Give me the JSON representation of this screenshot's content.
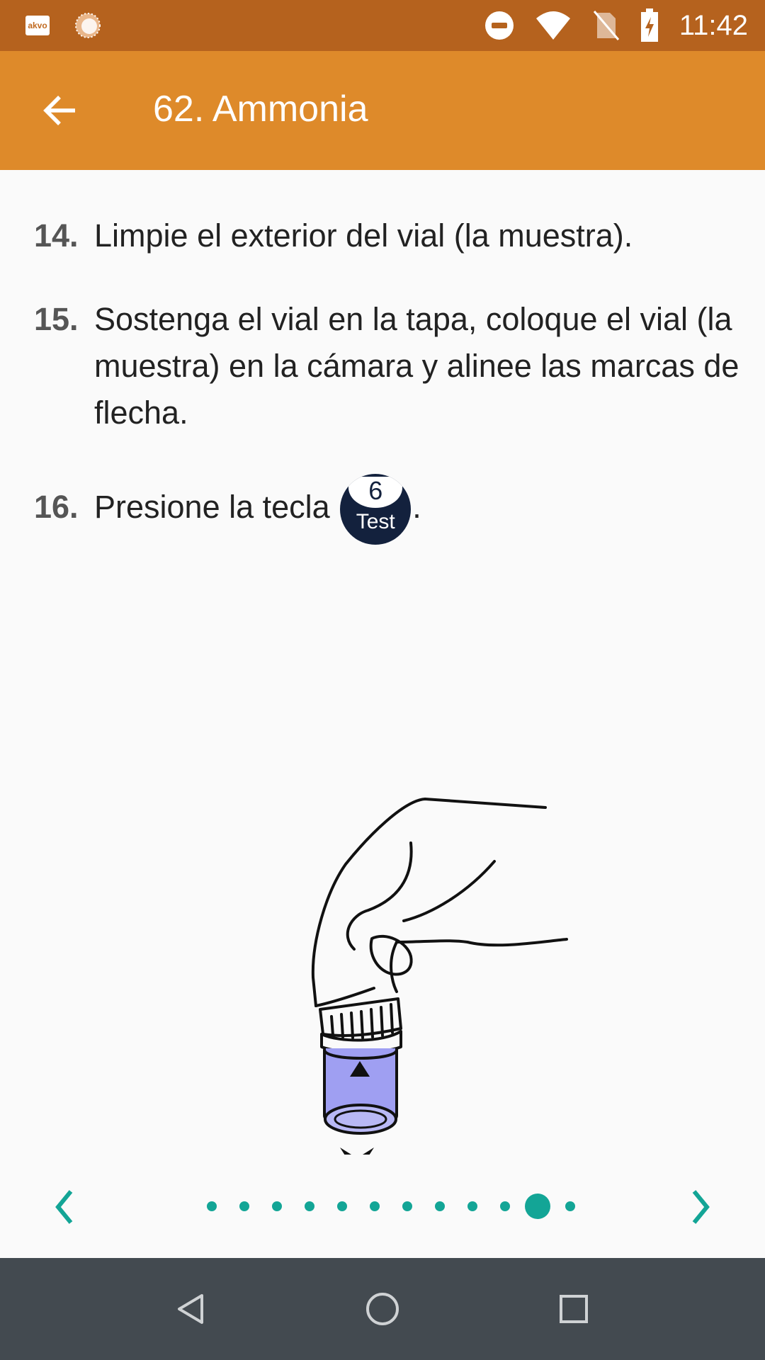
{
  "status_bar": {
    "app_badge": "akvo",
    "time": "11:42",
    "icons": [
      "akvo-app-icon",
      "sun-icon",
      "do-not-disturb-icon",
      "wifi-icon",
      "no-sim-icon",
      "battery-charging-icon"
    ]
  },
  "app_bar": {
    "title": "62. Ammonia",
    "back_icon": "arrow-left-icon"
  },
  "steps": [
    {
      "number": "14.",
      "text": "Limpie el exterior del vial (la muestra)."
    },
    {
      "number": "15.",
      "text": "Sostenga el vial en la tapa, coloque el vial (la muestra) en la cámara y alinee las marcas de flecha."
    },
    {
      "number": "16.",
      "text_before": "Presione la tecla",
      "text_after": ".",
      "key": {
        "number": "6",
        "label": "Test"
      }
    }
  ],
  "illustration": {
    "icon": "hand-inserting-vial-illustration",
    "vial_color": "#9f9ff2"
  },
  "pager": {
    "total_pages": 12,
    "current_page": 11,
    "prev_icon": "chevron-left-icon",
    "next_icon": "chevron-right-icon",
    "accent_color": "#13a596"
  },
  "nav_bar": {
    "icons": [
      "back-triangle-icon",
      "home-circle-icon",
      "recents-square-icon"
    ]
  },
  "colors": {
    "status_bar": "#b5621e",
    "app_bar": "#de8a2a",
    "nav_bar": "#434a50",
    "key_badge": "#13213d"
  }
}
